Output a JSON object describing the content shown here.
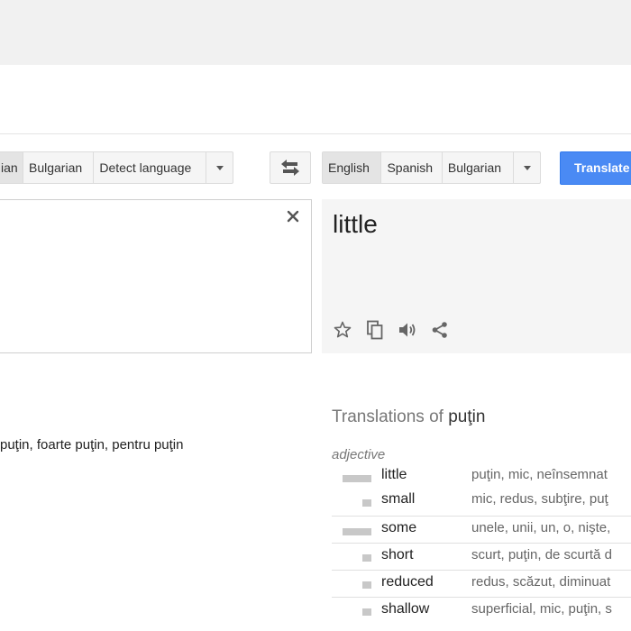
{
  "source_langbar": {
    "items": [
      {
        "label": "ian",
        "active": true
      },
      {
        "label": "Bulgarian",
        "active": false
      },
      {
        "label": "Detect language",
        "active": false
      }
    ]
  },
  "target_langbar": {
    "items": [
      {
        "label": "English",
        "active": true
      },
      {
        "label": "Spanish",
        "active": false
      },
      {
        "label": "Bulgarian",
        "active": false
      }
    ]
  },
  "translate_button": {
    "label": "Translate"
  },
  "result": {
    "text": "little"
  },
  "related": {
    "text": "puţin, foarte puţin, pentru puţin"
  },
  "translations": {
    "heading_prefix": "Translations of",
    "heading_word": "puţin",
    "pos": "adjective",
    "rows": [
      {
        "term": "little",
        "synonyms": "puţin, mic, neînsemnat",
        "frequency": "common"
      },
      {
        "term": "small",
        "synonyms": "mic, redus, subţire, puţ",
        "frequency": "uncommon"
      },
      {
        "term": "some",
        "synonyms": "unele, unii, un, o, nişte,",
        "frequency": "common"
      },
      {
        "term": "short",
        "synonyms": "scurt, puţin, de scurtă d",
        "frequency": "uncommon"
      },
      {
        "term": "reduced",
        "synonyms": "redus, scăzut, diminuat",
        "frequency": "uncommon"
      },
      {
        "term": "shallow",
        "synonyms": "superficial, mic, puţin, s",
        "frequency": "uncommon"
      }
    ]
  },
  "icons": {
    "swap": "swap-languages-icon",
    "clear": "close-icon",
    "star": "star-icon",
    "copy": "copy-icon",
    "listen": "speaker-icon",
    "share": "share-icon"
  },
  "colors": {
    "accent": "#4a8af4",
    "panel": "#f5f5f5"
  }
}
